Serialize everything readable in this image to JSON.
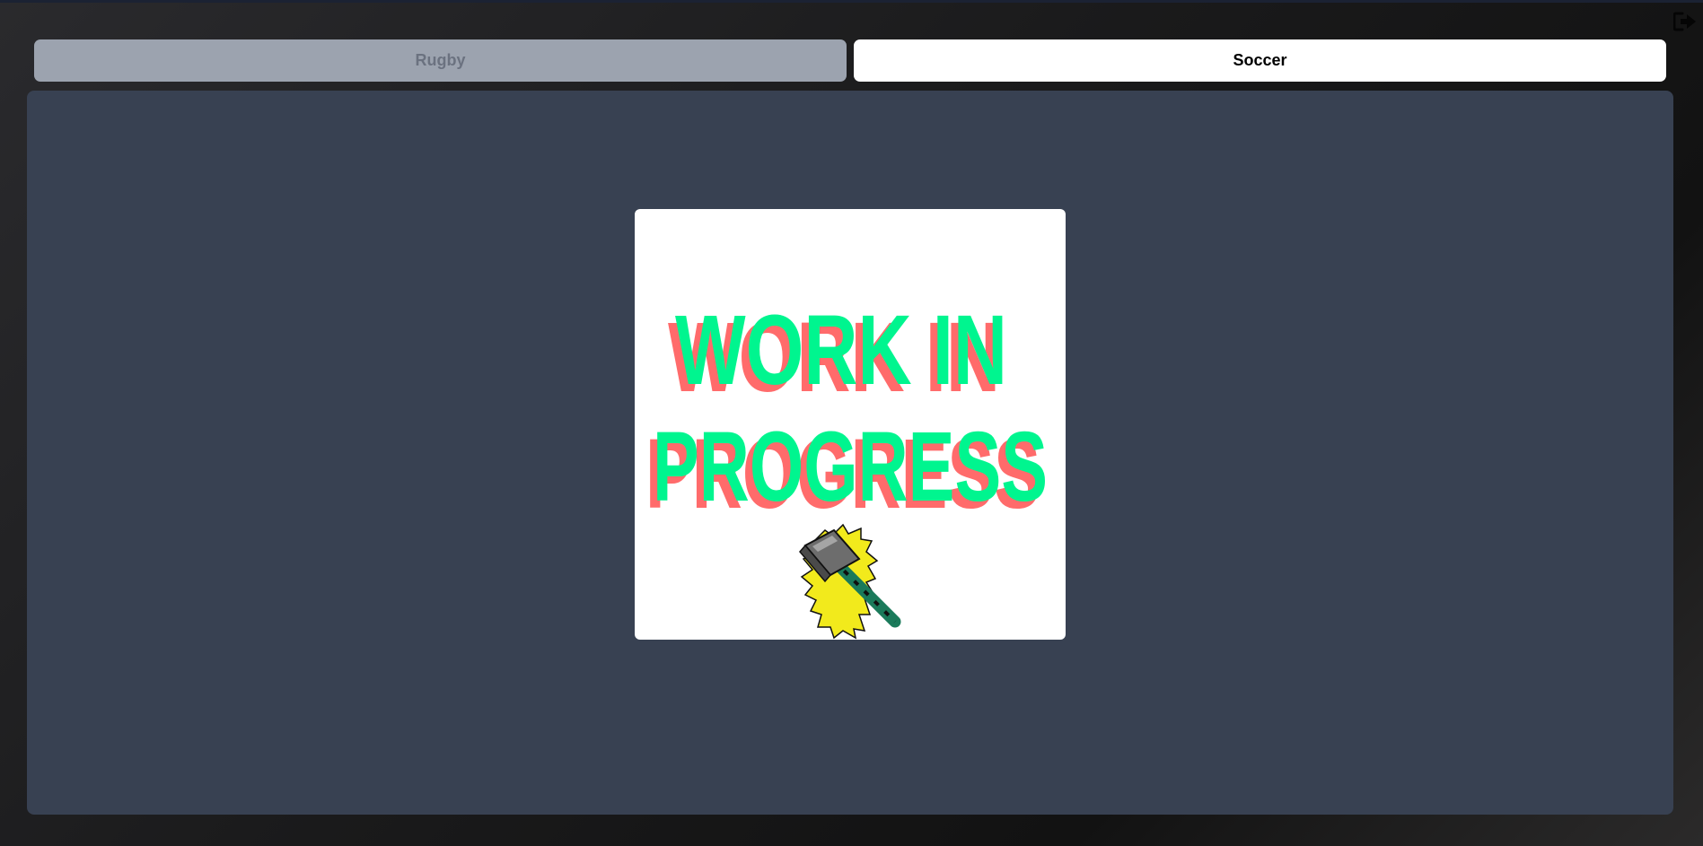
{
  "tabs": [
    {
      "label": "Rugby",
      "active": false
    },
    {
      "label": "Soccer",
      "active": true
    }
  ],
  "header": {
    "logout_icon": "logout-icon"
  },
  "main": {
    "image": {
      "line1": "WORK IN",
      "line2": "PROGRESS",
      "icon": "sledgehammer-icon"
    }
  },
  "colors": {
    "panel_bg": "#384152",
    "tab_inactive_bg": "#9ca3af",
    "tab_inactive_text": "#6b7280",
    "tab_active_bg": "#ffffff",
    "wip_text": "#00f58f",
    "wip_shadow": "#ff6b6b"
  }
}
